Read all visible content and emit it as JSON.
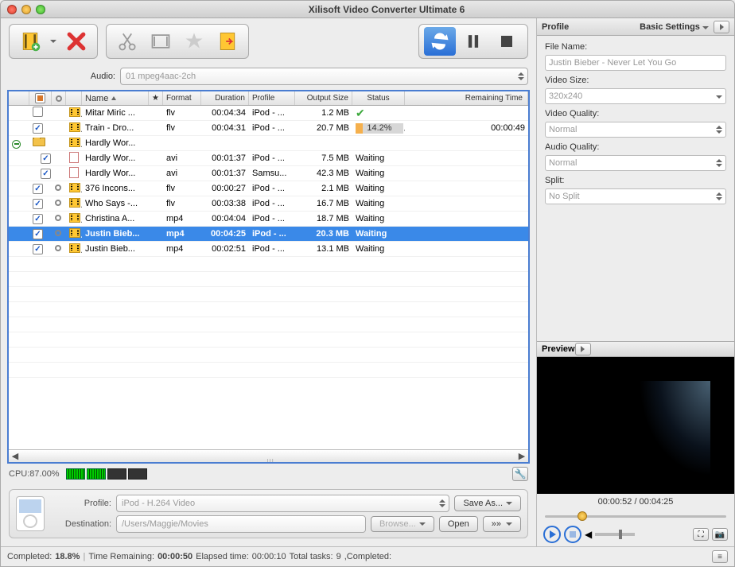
{
  "title": "Xilisoft Video Converter Ultimate 6",
  "audio": {
    "label": "Audio:",
    "value": "01 mpeg4aac-2ch"
  },
  "columns": {
    "name": "Name",
    "format": "Format",
    "duration": "Duration",
    "profile": "Profile",
    "output": "Output Size",
    "status": "Status",
    "remaining": "Remaining Time"
  },
  "rows": [
    {
      "tree": "",
      "chk": "off",
      "tgt": false,
      "ico": "film",
      "name": "Mitar Miric ...",
      "fmt": "flv",
      "dur": "00:04:34",
      "prof": "iPod - ...",
      "out": "1.2 MB",
      "status": "ok",
      "rem": ""
    },
    {
      "tree": "",
      "chk": "on",
      "tgt": false,
      "ico": "film",
      "name": "Train - Dro...",
      "fmt": "flv",
      "dur": "00:04:31",
      "prof": "iPod - ...",
      "out": "20.7 MB",
      "status": "progress",
      "pct": "14.2%",
      "rem": "00:00:49"
    },
    {
      "tree": "minus",
      "chk": "folder",
      "tgt": false,
      "ico": "film",
      "name": "Hardly Wor...",
      "fmt": "",
      "dur": "",
      "prof": "",
      "out": "",
      "status": "",
      "rem": ""
    },
    {
      "tree": "indent",
      "chk": "on",
      "tgt": false,
      "ico": "doc",
      "name": "Hardly Wor...",
      "fmt": "avi",
      "dur": "00:01:37",
      "prof": "iPod - ...",
      "out": "7.5 MB",
      "status": "Waiting",
      "rem": ""
    },
    {
      "tree": "indent",
      "chk": "on",
      "tgt": false,
      "ico": "doc",
      "name": "Hardly Wor...",
      "fmt": "avi",
      "dur": "00:01:37",
      "prof": "Samsu...",
      "out": "42.3 MB",
      "status": "Waiting",
      "rem": ""
    },
    {
      "tree": "",
      "chk": "on",
      "tgt": true,
      "ico": "film",
      "name": "376 Incons...",
      "fmt": "flv",
      "dur": "00:00:27",
      "prof": "iPod - ...",
      "out": "2.1 MB",
      "status": "Waiting",
      "rem": ""
    },
    {
      "tree": "",
      "chk": "on",
      "tgt": true,
      "ico": "film",
      "name": "Who Says -...",
      "fmt": "flv",
      "dur": "00:03:38",
      "prof": "iPod - ...",
      "out": "16.7 MB",
      "status": "Waiting",
      "rem": ""
    },
    {
      "tree": "",
      "chk": "on",
      "tgt": true,
      "ico": "film",
      "name": "Christina A...",
      "fmt": "mp4",
      "dur": "00:04:04",
      "prof": "iPod - ...",
      "out": "18.7 MB",
      "status": "Waiting",
      "rem": ""
    },
    {
      "tree": "",
      "chk": "on",
      "tgt": true,
      "ico": "film",
      "name": "Justin Bieb...",
      "fmt": "mp4",
      "dur": "00:04:25",
      "prof": "iPod - ...",
      "out": "20.3 MB",
      "status": "Waiting",
      "rem": "",
      "selected": true
    },
    {
      "tree": "",
      "chk": "on",
      "tgt": true,
      "ico": "film",
      "name": "Justin Bieb...",
      "fmt": "mp4",
      "dur": "00:02:51",
      "prof": "iPod - ...",
      "out": "13.1 MB",
      "status": "Waiting",
      "rem": ""
    }
  ],
  "cpu": {
    "label": "CPU:87.00%"
  },
  "profile": {
    "label": "Profile:",
    "value": "iPod - H.264 Video",
    "save": "Save As..."
  },
  "dest": {
    "label": "Destination:",
    "value": "/Users/Maggie/Movies",
    "browse": "Browse...",
    "open": "Open"
  },
  "status": {
    "completed_lbl": "Completed:",
    "completed_val": "18.8%",
    "remain_lbl": "Time Remaining:",
    "remain_val": "00:00:50",
    "elapsed_lbl": "Elapsed time:",
    "elapsed_val": "00:00:10",
    "tasks_lbl": "Total tasks:",
    "tasks_val": "9",
    "comp2": ",Completed:"
  },
  "right": {
    "panel_title": "Profile",
    "basic": "Basic Settings",
    "filename_lbl": "File Name:",
    "filename": "Justin Bieber - Never Let You Go",
    "vsize_lbl": "Video Size:",
    "vsize": "320x240",
    "vq_lbl": "Video Quality:",
    "vq": "Normal",
    "aq_lbl": "Audio Quality:",
    "aq": "Normal",
    "split_lbl": "Split:",
    "split": "No Split",
    "preview_lbl": "Preview",
    "time": "00:00:52 / 00:04:25"
  }
}
